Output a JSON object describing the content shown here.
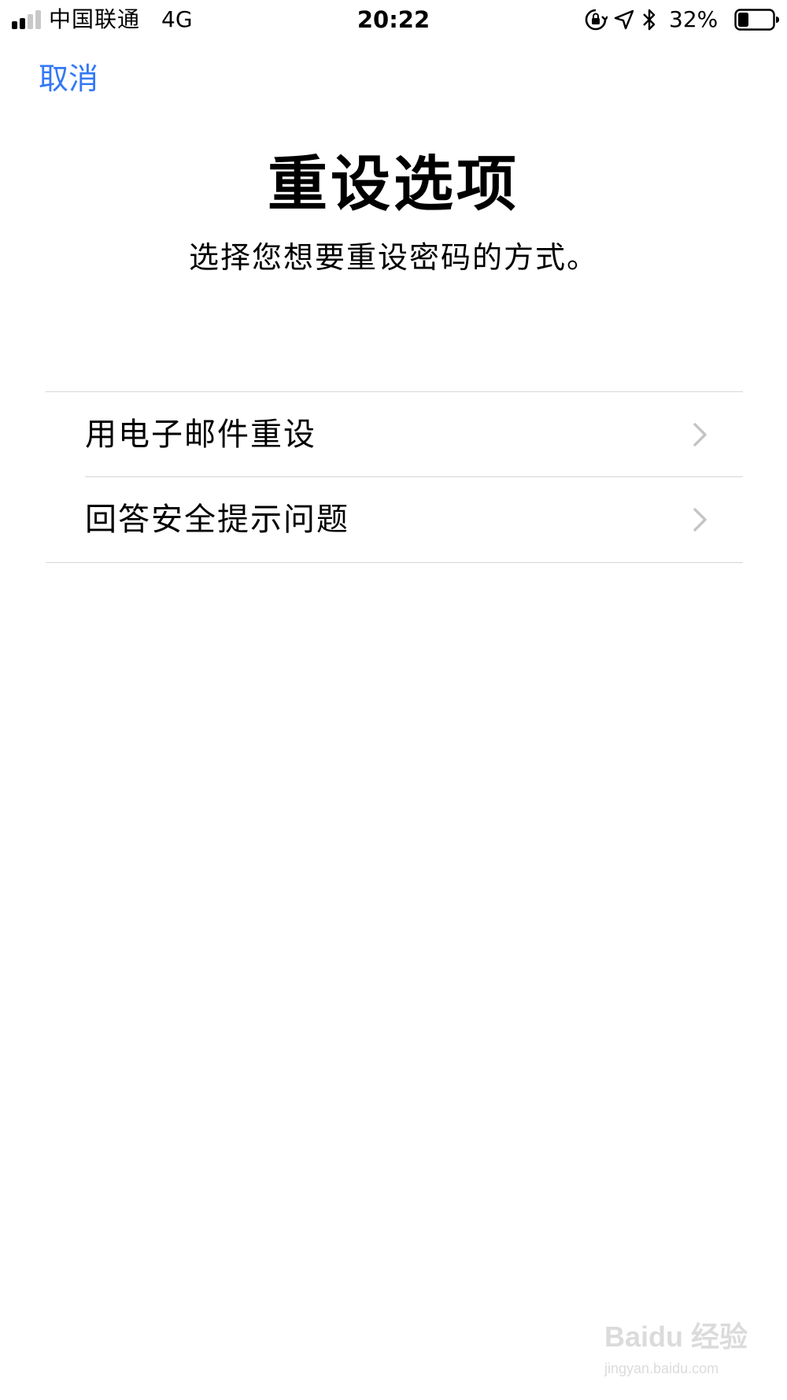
{
  "status_bar": {
    "carrier": "中国联通",
    "network": "4G",
    "time": "20:22",
    "battery_percent": "32%",
    "battery_level": 0.32,
    "signal_bars_filled": 2,
    "signal_bars_total": 4
  },
  "nav": {
    "cancel_label": "取消"
  },
  "header": {
    "title": "重设选项",
    "subtitle": "选择您想要重设密码的方式。"
  },
  "options": [
    {
      "label": "用电子邮件重设"
    },
    {
      "label": "回答安全提示问题"
    }
  ],
  "watermark": {
    "brand": "Baidu 经验",
    "url": "jingyan.baidu.com"
  },
  "colors": {
    "accent": "#3478f6",
    "separator": "#d6d6d6",
    "chevron": "#c4c4c8",
    "text": "#000000",
    "background": "#ffffff"
  },
  "icons": {
    "signal": "signal-bars-icon",
    "rotation_lock": "rotation-lock-icon",
    "location": "location-arrow-icon",
    "bluetooth": "bluetooth-icon",
    "battery": "battery-icon",
    "chevron": "chevron-right-icon"
  }
}
